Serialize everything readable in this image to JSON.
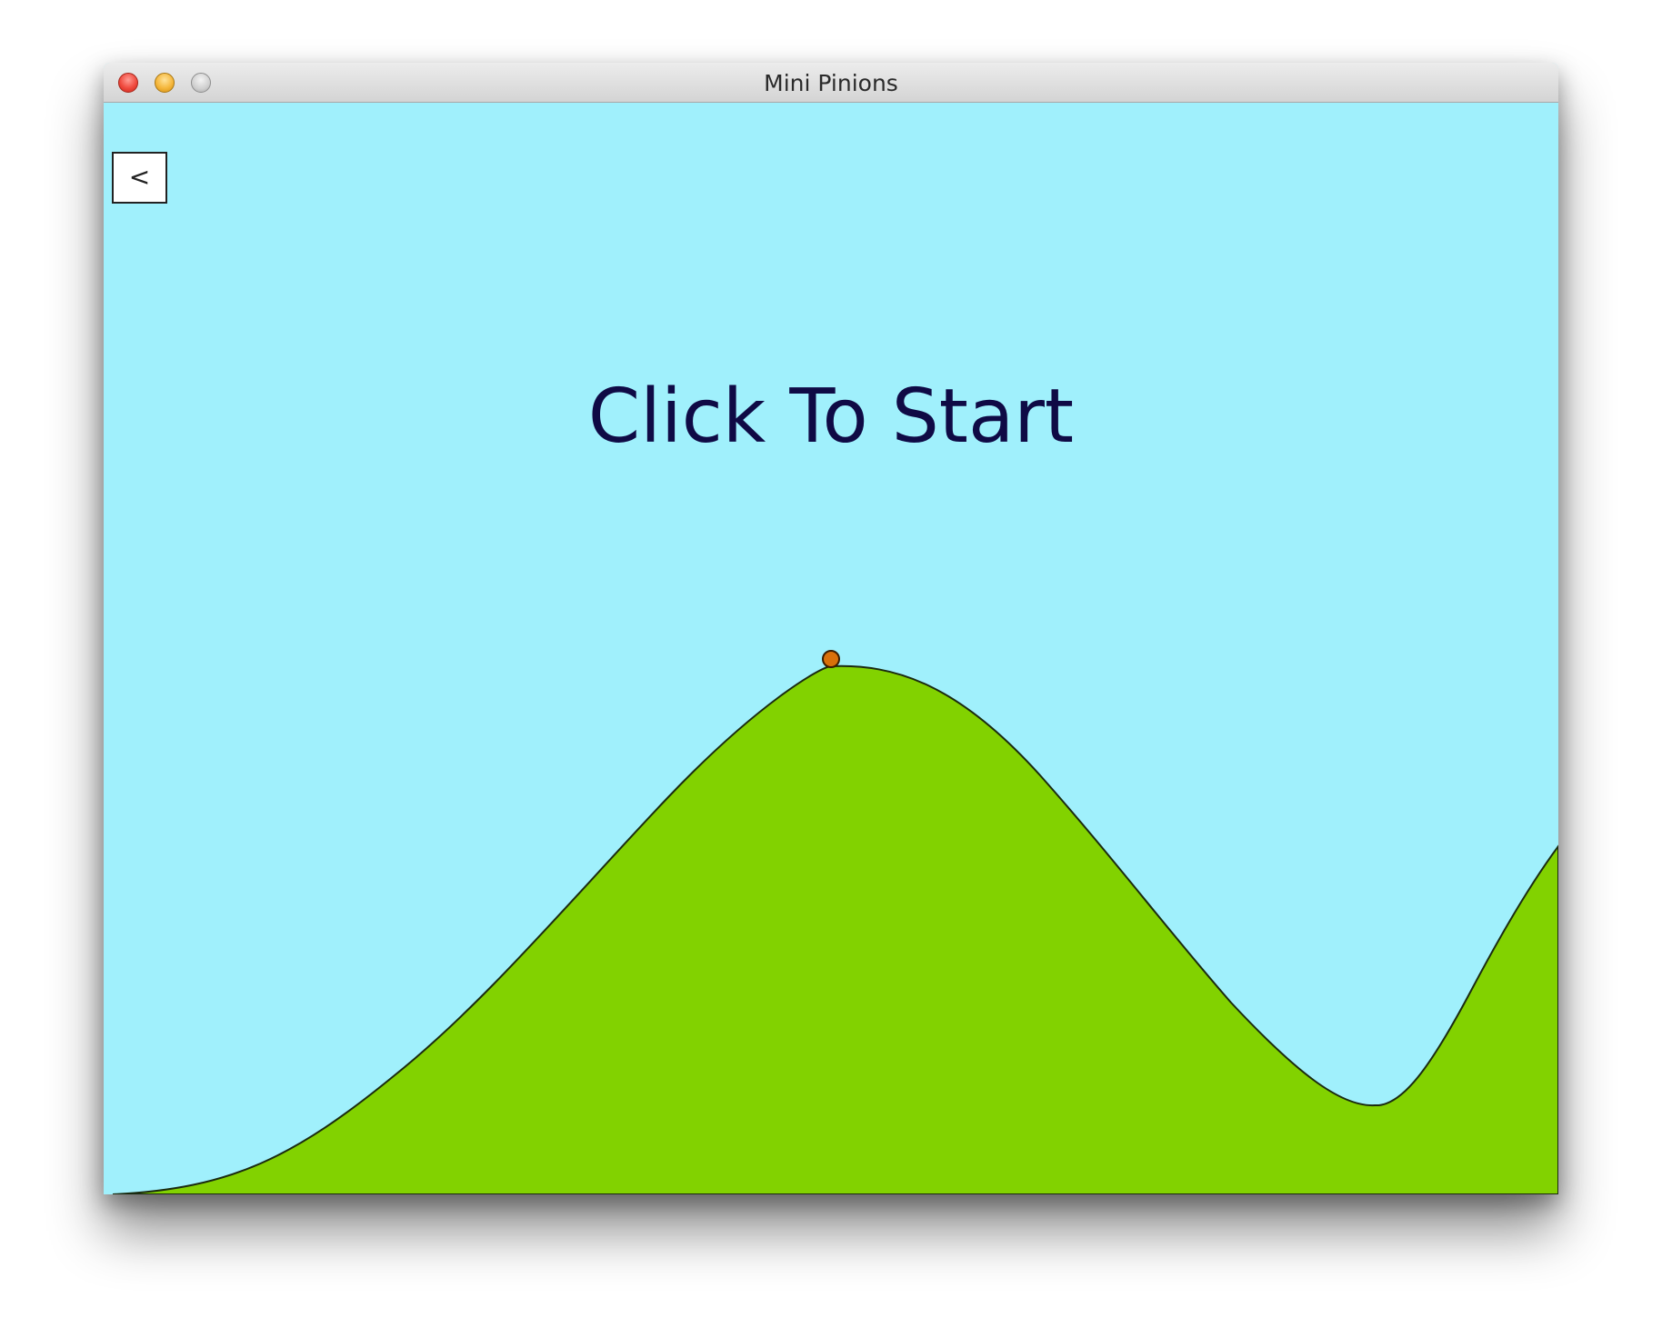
{
  "window": {
    "title": "Mini Pinions"
  },
  "game": {
    "back_label": "<",
    "start_prompt": "Click To Start",
    "colors": {
      "sky": "#a0f0fc",
      "hill": "#82d200",
      "hill_outline": "#1a2a10",
      "ball": "#d9700a",
      "prompt_text": "#0f0a45"
    }
  }
}
